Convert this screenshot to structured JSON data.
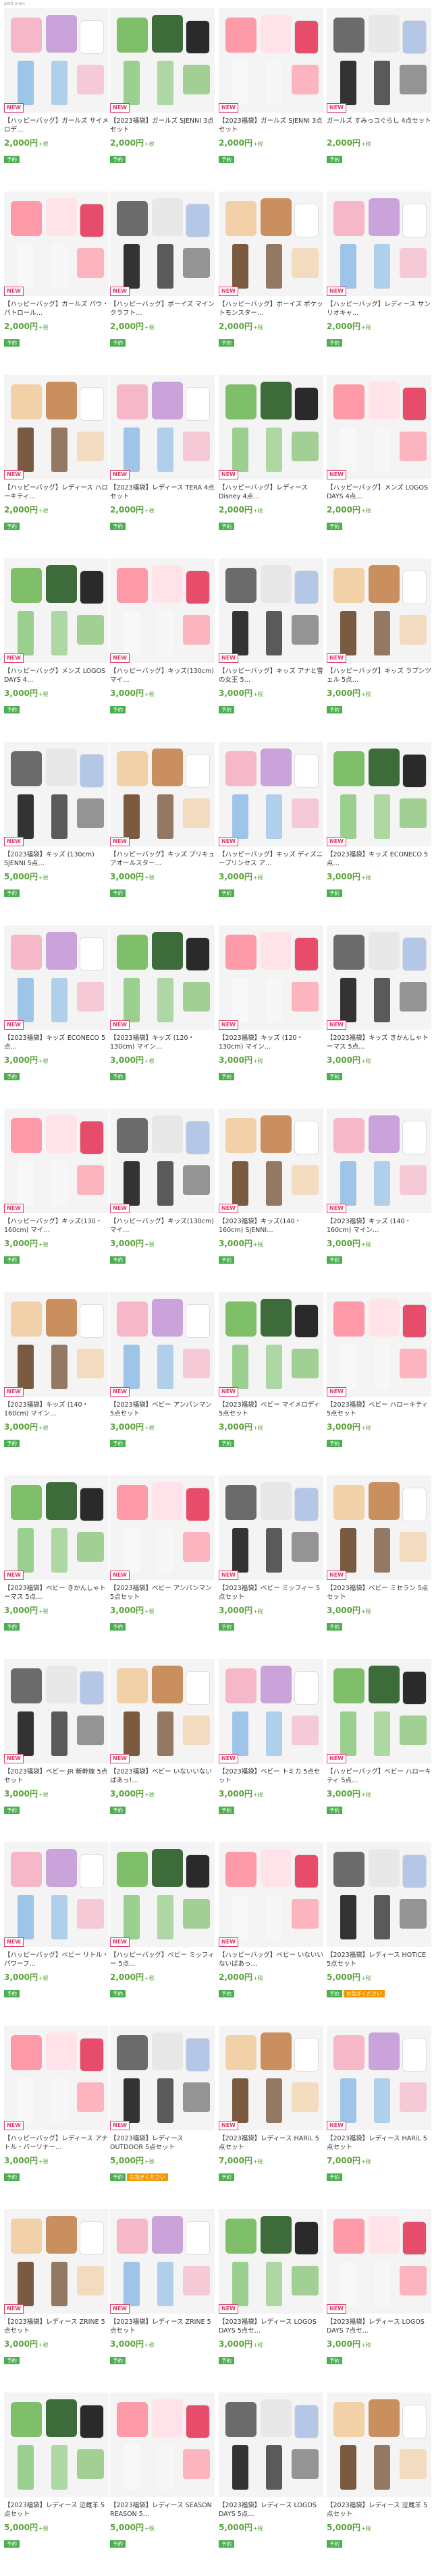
{
  "header": {
    "small_logo": "petit main"
  },
  "colors": {
    "price": "#5aa33a",
    "new_badge": "#e23a67",
    "reserve_badge": "#4bae4f",
    "hurry_badge": "#f39800"
  },
  "products": [
    {
      "title": "【ハッピーバッグ】ガールズ サイメロデ…",
      "price": "2,000円",
      "tax": "+税",
      "new": true,
      "badges": [
        "予約"
      ]
    },
    {
      "title": "【2023福袋】ガールズ SJENNI 3点セット",
      "price": "2,000円",
      "tax": "+税",
      "new": true,
      "badges": [
        "予約"
      ]
    },
    {
      "title": "【2023福袋】ガールズ SJENNI 3点セット",
      "price": "2,000円",
      "tax": "+税",
      "new": true,
      "badges": [
        "予約"
      ]
    },
    {
      "title": "ガールズ すみっコぐらし 4点セット",
      "price": "2,000円",
      "tax": "+税",
      "new": true,
      "badges": [
        "予約"
      ]
    },
    {
      "title": "【ハッピーバッグ】ガールズ パウ・パトロール…",
      "price": "2,000円",
      "tax": "+税",
      "new": true,
      "badges": [
        "予約"
      ]
    },
    {
      "title": "【ハッピーバッグ】ボーイズ マインクラフト…",
      "price": "2,000円",
      "tax": "+税",
      "new": true,
      "badges": [
        "予約"
      ]
    },
    {
      "title": "【ハッピーバッグ】ボーイズ ポケットモンスター…",
      "price": "2,000円",
      "tax": "+税",
      "new": true,
      "badges": [
        "予約"
      ]
    },
    {
      "title": "【ハッピーバッグ】レディース サンリオキャ…",
      "price": "2,000円",
      "tax": "+税",
      "new": true,
      "badges": [
        "予約"
      ]
    },
    {
      "title": "【ハッピーバッグ】レディース ハローキティ…",
      "price": "2,000円",
      "tax": "+税",
      "new": true,
      "badges": [
        "予約"
      ]
    },
    {
      "title": "【2023福袋】レディース TERA 4点セット",
      "price": "2,000円",
      "tax": "+税",
      "new": true,
      "badges": [
        "予約"
      ]
    },
    {
      "title": "【ハッピーバッグ】レディース Disney 4点…",
      "price": "2,000円",
      "tax": "+税",
      "new": true,
      "badges": [
        "予約"
      ]
    },
    {
      "title": "【ハッピーバッグ】メンズ LOGOS DAYS 4点…",
      "price": "2,000円",
      "tax": "+税",
      "new": true,
      "badges": [
        "予約"
      ]
    },
    {
      "title": "【ハッピーバッグ】メンズ LOGOS DAYS 4…",
      "price": "3,000円",
      "tax": "+税",
      "new": true,
      "badges": [
        "予約"
      ]
    },
    {
      "title": "【ハッピーバッグ】キッズ(130cm) マイ…",
      "price": "3,000円",
      "tax": "+税",
      "new": true,
      "badges": [
        "予約"
      ]
    },
    {
      "title": "【ハッピーバッグ】キッズ アナと雪の女王 5…",
      "price": "3,000円",
      "tax": "+税",
      "new": true,
      "badges": [
        "予約"
      ]
    },
    {
      "title": "【ハッピーバッグ】キッズ ラプンツェル 5点…",
      "price": "3,000円",
      "tax": "+税",
      "new": true,
      "badges": [
        "予約"
      ]
    },
    {
      "title": "【2023福袋】キッズ (130cm) SJENNI 5点…",
      "price": "5,000円",
      "tax": "+税",
      "new": true,
      "badges": [
        "予約"
      ]
    },
    {
      "title": "【ハッピーバッグ】キッズ プリキュアオールスター…",
      "price": "3,000円",
      "tax": "+税",
      "new": true,
      "badges": [
        "予約"
      ]
    },
    {
      "title": "【ハッピーバッグ】キッズ ディズニープリンセス ア…",
      "price": "3,000円",
      "tax": "+税",
      "new": true,
      "badges": [
        "予約"
      ]
    },
    {
      "title": "【2023福袋】キッズ ECONECO 5点…",
      "price": "3,000円",
      "tax": "+税",
      "new": true,
      "badges": [
        "予約"
      ]
    },
    {
      "title": "【2023福袋】キッズ ECONECO 5点…",
      "price": "3,000円",
      "tax": "+税",
      "new": true,
      "badges": [
        "予約"
      ]
    },
    {
      "title": "【2023福袋】キッズ (120・130cm) マイン…",
      "price": "3,000円",
      "tax": "+税",
      "new": true,
      "badges": [
        "予約"
      ]
    },
    {
      "title": "【2023福袋】キッズ (120・130cm) マイン…",
      "price": "3,000円",
      "tax": "+税",
      "new": true,
      "badges": [
        "予約"
      ]
    },
    {
      "title": "【2023福袋】キッズ きかんしゃトーマス 5点…",
      "price": "3,000円",
      "tax": "+税",
      "new": true,
      "badges": [
        "予約"
      ]
    },
    {
      "title": "【ハッピーバッグ】キッズ(130・160cm) マイ…",
      "price": "3,000円",
      "tax": "+税",
      "new": true,
      "badges": [
        "予約"
      ]
    },
    {
      "title": "【ハッピーバッグ】キッズ(130cm) マイ…",
      "price": "3,000円",
      "tax": "+税",
      "new": true,
      "badges": [
        "予約"
      ]
    },
    {
      "title": "【2023福袋】キッズ(140・160cm) SJENNI…",
      "price": "3,000円",
      "tax": "+税",
      "new": true,
      "badges": [
        "予約"
      ]
    },
    {
      "title": "【2023福袋】キッズ (140・160cm) マイン…",
      "price": "3,000円",
      "tax": "+税",
      "new": true,
      "badges": [
        "予約"
      ]
    },
    {
      "title": "【2023福袋】キッズ (140・160cm) マイン…",
      "price": "3,000円",
      "tax": "+税",
      "new": true,
      "badges": [
        "予約"
      ]
    },
    {
      "title": "【2023福袋】ベビー アンパンマン 5点セット",
      "price": "3,000円",
      "tax": "+税",
      "new": true,
      "badges": [
        "予約"
      ]
    },
    {
      "title": "【2023福袋】ベビー マイメロディ 5点セット",
      "price": "3,000円",
      "tax": "+税",
      "new": true,
      "badges": [
        "予約"
      ]
    },
    {
      "title": "【2023福袋】ベビー ハローキティ 5点セット",
      "price": "3,000円",
      "tax": "+税",
      "new": true,
      "badges": [
        "予約"
      ]
    },
    {
      "title": "【2023福袋】ベビー きかんしゃトーマス 5点…",
      "price": "3,000円",
      "tax": "+税",
      "new": true,
      "badges": [
        "予約"
      ]
    },
    {
      "title": "【2023福袋】ベビー アンパンマン 5点セット",
      "price": "3,000円",
      "tax": "+税",
      "new": true,
      "badges": [
        "予約"
      ]
    },
    {
      "title": "【2023福袋】ベビー ミッフィー 5点セット",
      "price": "3,000円",
      "tax": "+税",
      "new": true,
      "badges": [
        "予約"
      ]
    },
    {
      "title": "【2023福袋】ベビー ミセラン 5点セット",
      "price": "3,000円",
      "tax": "+税",
      "new": true,
      "badges": [
        "予約"
      ]
    },
    {
      "title": "【2023福袋】ベビー JR 新幹線 5点セット",
      "price": "3,000円",
      "tax": "+税",
      "new": true,
      "badges": [
        "予約"
      ]
    },
    {
      "title": "【2023福袋】ベビー いないいないばあっ!…",
      "price": "3,000円",
      "tax": "+税",
      "new": true,
      "badges": [
        "予約"
      ]
    },
    {
      "title": "【2023福袋】ベビー トミカ 5点セット",
      "price": "3,000円",
      "tax": "+税",
      "new": true,
      "badges": [
        "予約"
      ]
    },
    {
      "title": "【ハッピーバッグ】ベビー ハローキティ 5点…",
      "price": "3,000円",
      "tax": "+税",
      "new": true,
      "badges": [
        "予約"
      ]
    },
    {
      "title": "【ハッピーバッグ】ベビー リトル・パワーフ…",
      "price": "3,000円",
      "tax": "+税",
      "new": true,
      "badges": [
        "予約"
      ]
    },
    {
      "title": "【ハッピーバッグ】ベビー ミッフィー 5点…",
      "price": "2,000円",
      "tax": "+税",
      "new": true,
      "badges": [
        "予約"
      ]
    },
    {
      "title": "【ハッピーバッグ】ベビー いないいないばあっ…",
      "price": "2,000円",
      "tax": "+税",
      "new": true,
      "badges": [
        "予約"
      ]
    },
    {
      "title": "【2023福袋】レディース HOTiCE 5点セット",
      "price": "5,000円",
      "tax": "+税",
      "new": false,
      "badges": [
        "予約",
        "お急ぎください"
      ]
    },
    {
      "title": "【ハッピーバッグ】レディース アナトル・パーソナー…",
      "price": "3,000円",
      "tax": "+税",
      "new": true,
      "badges": [
        "予約"
      ]
    },
    {
      "title": "【2023福袋】レディース OUTDOOR 5点セット",
      "price": "5,000円",
      "tax": "+税",
      "new": true,
      "badges": [
        "予約",
        "お急ぎください"
      ]
    },
    {
      "title": "【2023福袋】レディース HARiL 5点セット",
      "price": "7,000円",
      "tax": "+税",
      "new": true,
      "badges": [
        "予約"
      ]
    },
    {
      "title": "【2023福袋】レディース HARiL 5点セット",
      "price": "7,000円",
      "tax": "+税",
      "new": true,
      "badges": [
        "予約"
      ]
    },
    {
      "title": "【2023福袋】レディース ZRINE 5点セット",
      "price": "3,000円",
      "tax": "+税",
      "new": true,
      "badges": [
        "予約"
      ]
    },
    {
      "title": "【2023福袋】レディース ZRINE 5点セット",
      "price": "3,000円",
      "tax": "+税",
      "new": true,
      "badges": [
        "予約"
      ]
    },
    {
      "title": "【2023福袋】レディース LOGOS DAYS 5点セ…",
      "price": "3,000円",
      "tax": "+税",
      "new": true,
      "badges": [
        "予約"
      ]
    },
    {
      "title": "【2023福袋】レディース LOGOS DAYS 7点セ…",
      "price": "3,000円",
      "tax": "+税",
      "new": true,
      "badges": [
        "予約"
      ]
    },
    {
      "title": "【2023福袋】レディース 泣蔵羊 5点セット",
      "price": "5,000円",
      "tax": "+税",
      "new": false,
      "badges": [
        "予約"
      ]
    },
    {
      "title": "【2023福袋】レディース SEASON REASON 5…",
      "price": "5,000円",
      "tax": "+税",
      "new": false,
      "badges": [
        "予約"
      ]
    },
    {
      "title": "【2023福袋】レディース LOGOS DAYS 5点…",
      "price": "5,000円",
      "tax": "+税",
      "new": false,
      "badges": [
        "予約"
      ]
    },
    {
      "title": "【2023福袋】レディース 泣蔵羊 5点セット",
      "price": "5,000円",
      "tax": "+税",
      "new": false,
      "badges": [
        "予約"
      ]
    }
  ]
}
